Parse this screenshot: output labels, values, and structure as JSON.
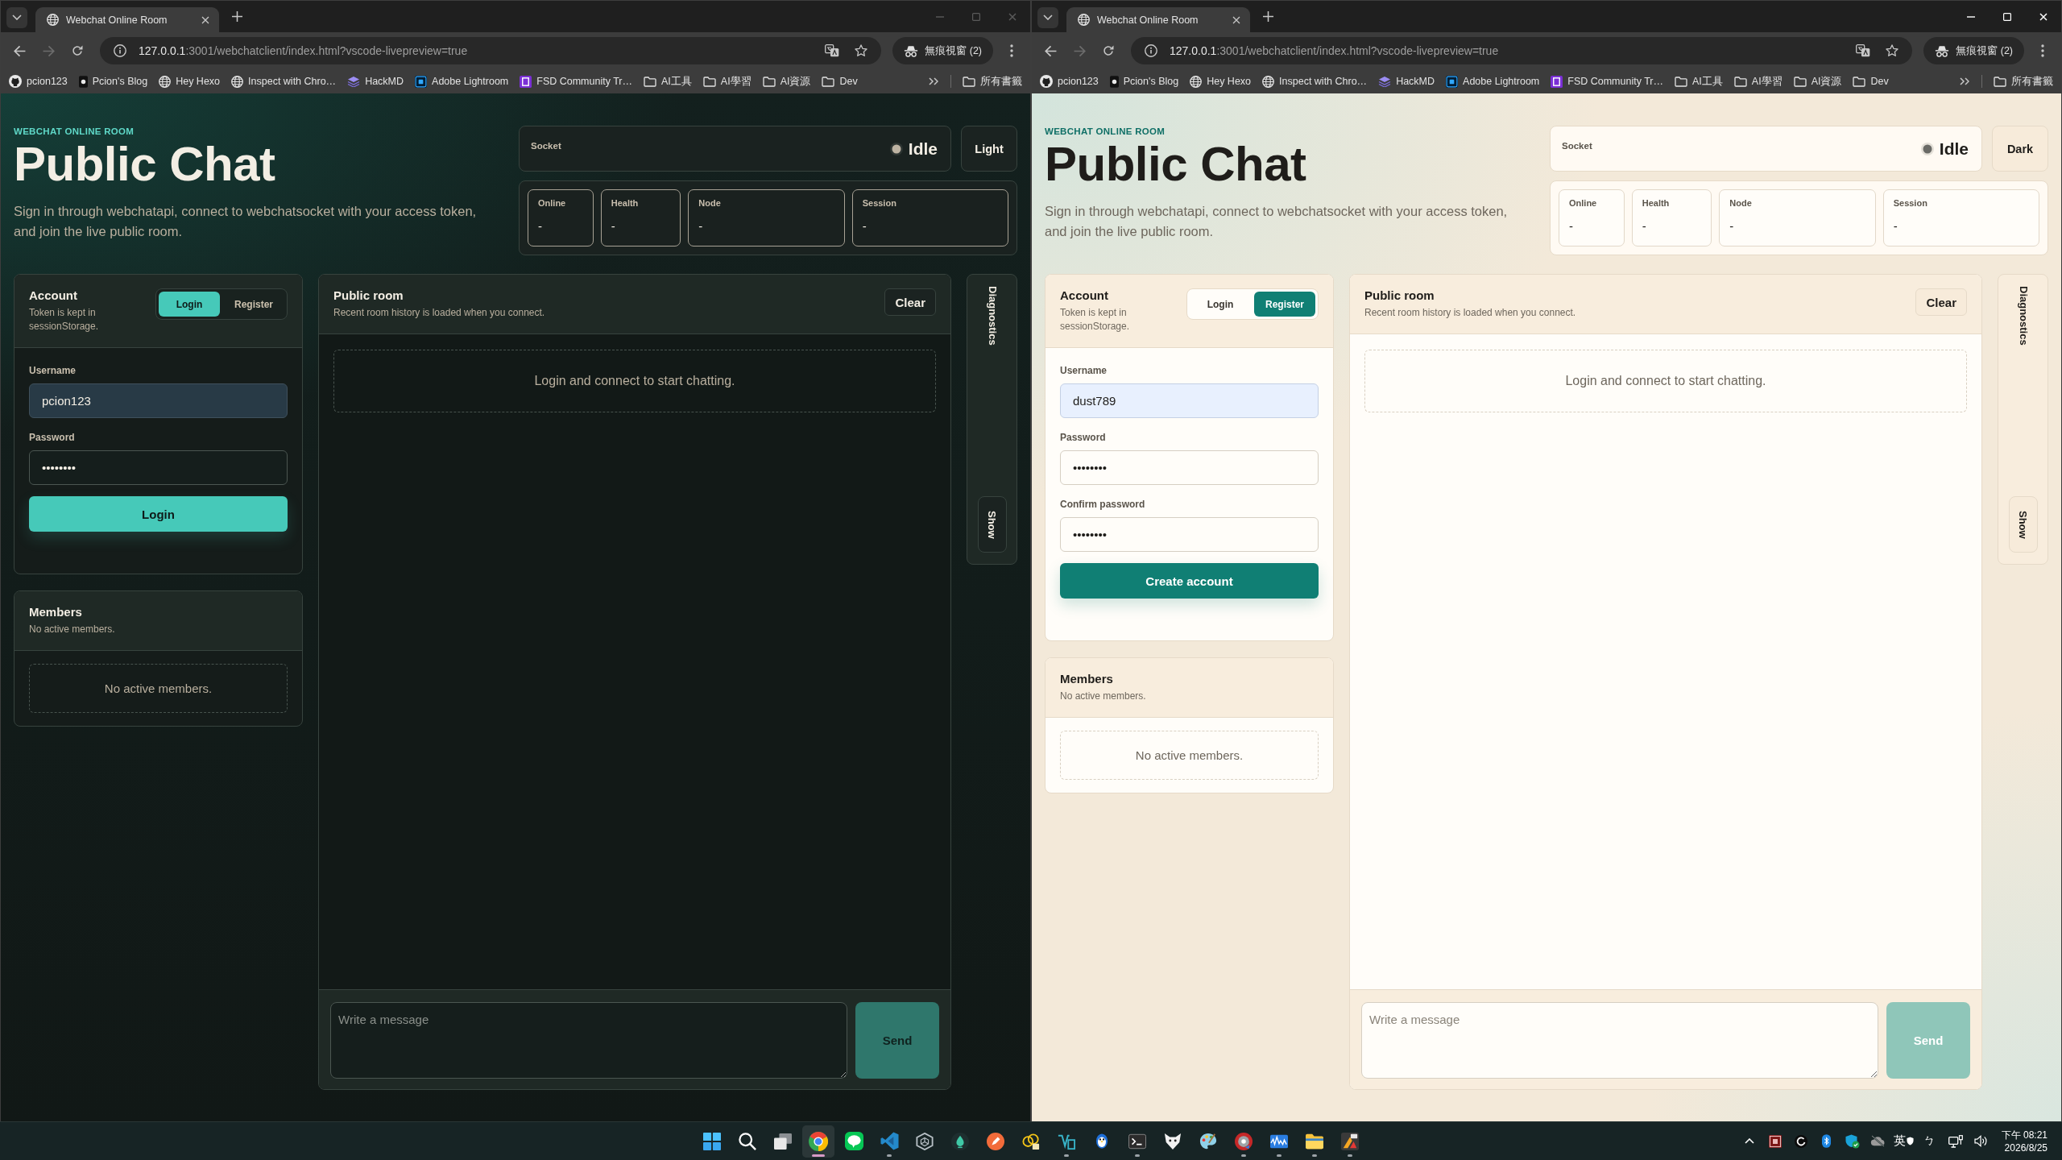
{
  "windows": [
    {
      "kind": "dark",
      "focused": false,
      "browser": {
        "tab_title": "Webchat Online Room",
        "url": {
          "host": "127.0.0.1",
          "path": ":3001/webchatclient/index.html?vscode-livepreview=true"
        },
        "forward_disabled": true,
        "profile_label": "無痕視窗 (2)",
        "bookmarks": [
          {
            "kind": "github",
            "label": "pcion123"
          },
          {
            "kind": "blog",
            "label": "Pcion's Blog"
          },
          {
            "kind": "globe",
            "label": "Hey Hexo"
          },
          {
            "kind": "globe",
            "label": "Inspect with Chro…"
          },
          {
            "kind": "hackmd",
            "label": "HackMD"
          },
          {
            "kind": "lightroom",
            "label": "Adobe Lightroom"
          },
          {
            "kind": "fsd",
            "label": "FSD Community Tr…"
          },
          {
            "kind": "folder",
            "label": "AI工具"
          },
          {
            "kind": "folder",
            "label": "AI學習"
          },
          {
            "kind": "folder",
            "label": "AI資源"
          },
          {
            "kind": "folder",
            "label": "Dev"
          }
        ],
        "all_bookmarks": "所有書籤"
      },
      "page": {
        "eyebrow": "WEBCHAT ONLINE ROOM",
        "title": "Public Chat",
        "description": "Sign in through webchatapi, connect to webchatsocket with your access token, and join the live public room.",
        "socket": {
          "label": "Socket",
          "status": "Idle"
        },
        "theme_toggle": "Light",
        "stats": [
          {
            "label": "Online",
            "value": "-"
          },
          {
            "label": "Health",
            "value": "-"
          },
          {
            "label": "Node",
            "value": "-"
          },
          {
            "label": "Session",
            "value": "-"
          }
        ],
        "account": {
          "title": "Account",
          "note": "Token is kept in sessionStorage.",
          "tabs": [
            {
              "label": "Login",
              "selected": true
            },
            {
              "label": "Register",
              "selected": false
            }
          ],
          "fields": [
            {
              "label": "Username",
              "value": "pcion123",
              "autofilled": true
            },
            {
              "label": "Password",
              "value": "••••••••",
              "autofilled": false
            }
          ],
          "submit": "Login"
        },
        "members": {
          "title": "Members",
          "note": "No active members.",
          "empty": "No active members."
        },
        "room": {
          "title": "Public room",
          "note": "Recent room history is loaded when you connect.",
          "clear": "Clear",
          "empty": "Login and connect to start chatting.",
          "composer": {
            "placeholder": "Write a message"
          },
          "send": {
            "label": "Send",
            "disabled": true
          }
        },
        "diagnostics": {
          "title": "Diagnostics",
          "toggle": "Show"
        }
      }
    },
    {
      "kind": "light",
      "focused": true,
      "browser": {
        "tab_title": "Webchat Online Room",
        "url": {
          "host": "127.0.0.1",
          "path": ":3001/webchatclient/index.html?vscode-livepreview=true"
        },
        "forward_disabled": true,
        "profile_label": "無痕視窗 (2)",
        "bookmarks": [
          {
            "kind": "github",
            "label": "pcion123"
          },
          {
            "kind": "blog",
            "label": "Pcion's Blog"
          },
          {
            "kind": "globe",
            "label": "Hey Hexo"
          },
          {
            "kind": "globe",
            "label": "Inspect with Chro…"
          },
          {
            "kind": "hackmd",
            "label": "HackMD"
          },
          {
            "kind": "lightroom",
            "label": "Adobe Lightroom"
          },
          {
            "kind": "fsd",
            "label": "FSD Community Tr…"
          },
          {
            "kind": "folder",
            "label": "AI工具"
          },
          {
            "kind": "folder",
            "label": "AI學習"
          },
          {
            "kind": "folder",
            "label": "AI資源"
          },
          {
            "kind": "folder",
            "label": "Dev"
          }
        ],
        "all_bookmarks": "所有書籤"
      },
      "page": {
        "eyebrow": "WEBCHAT ONLINE ROOM",
        "title": "Public Chat",
        "description": "Sign in through webchatapi, connect to webchatsocket with your access token, and join the live public room.",
        "socket": {
          "label": "Socket",
          "status": "Idle"
        },
        "theme_toggle": "Dark",
        "stats": [
          {
            "label": "Online",
            "value": "-"
          },
          {
            "label": "Health",
            "value": "-"
          },
          {
            "label": "Node",
            "value": "-"
          },
          {
            "label": "Session",
            "value": "-"
          }
        ],
        "account": {
          "title": "Account",
          "note": "Token is kept in sessionStorage.",
          "tabs": [
            {
              "label": "Login",
              "selected": false
            },
            {
              "label": "Register",
              "selected": true
            }
          ],
          "fields": [
            {
              "label": "Username",
              "value": "dust789",
              "autofilled": true
            },
            {
              "label": "Password",
              "value": "••••••••",
              "autofilled": false
            },
            {
              "label": "Confirm password",
              "value": "••••••••",
              "autofilled": false
            }
          ],
          "submit": "Create account"
        },
        "members": {
          "title": "Members",
          "note": "No active members.",
          "empty": "No active members."
        },
        "room": {
          "title": "Public room",
          "note": "Recent room history is loaded when you connect.",
          "clear": "Clear",
          "empty": "Login and connect to start chatting.",
          "composer": {
            "placeholder": "Write a message"
          },
          "send": {
            "label": "Send",
            "disabled": true
          }
        },
        "diagnostics": {
          "title": "Diagnostics",
          "toggle": "Show"
        }
      }
    }
  ],
  "taskbar": {
    "apps": [
      {
        "kind": "start",
        "running": false,
        "active": false
      },
      {
        "kind": "search",
        "running": false,
        "active": false
      },
      {
        "kind": "taskview",
        "running": false,
        "active": false
      },
      {
        "kind": "browser",
        "running": true,
        "active": true
      },
      {
        "kind": "chat",
        "running": false,
        "active": false
      },
      {
        "kind": "editor",
        "running": true,
        "active": false
      },
      {
        "kind": "hexagon",
        "running": false,
        "active": false
      },
      {
        "kind": "drop",
        "running": false,
        "active": false
      },
      {
        "kind": "pen",
        "running": false,
        "active": false
      },
      {
        "kind": "circles",
        "running": false,
        "active": false
      },
      {
        "kind": "outline",
        "running": true,
        "active": false
      },
      {
        "kind": "penguin",
        "running": false,
        "active": false
      },
      {
        "kind": "terminal",
        "running": true,
        "active": false
      },
      {
        "kind": "fox",
        "running": false,
        "active": false
      },
      {
        "kind": "palette",
        "running": false,
        "active": false
      },
      {
        "kind": "disc",
        "running": true,
        "active": false
      },
      {
        "kind": "wave",
        "running": true,
        "active": false
      },
      {
        "kind": "folder",
        "running": true,
        "active": false
      },
      {
        "kind": "tile",
        "running": true,
        "active": false
      }
    ],
    "tray": {
      "input_mode": "英",
      "input_layout": "ㄅ"
    },
    "clock": {
      "time": "下午 08:21",
      "date": "2026/8/25"
    }
  }
}
